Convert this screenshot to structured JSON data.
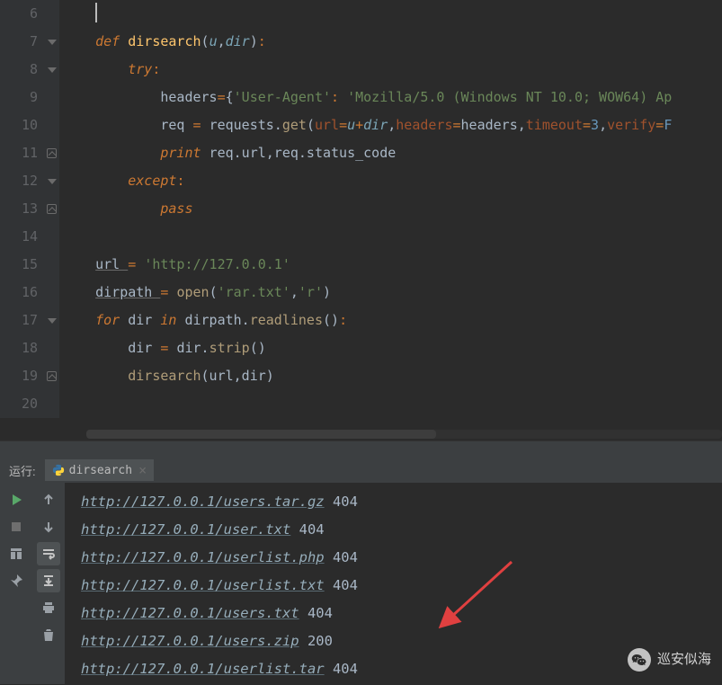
{
  "editor": {
    "lines": [
      {
        "n": 6,
        "fold": null,
        "tokens": [
          {
            "t": "cursor"
          }
        ],
        "indent": 0
      },
      {
        "n": 7,
        "fold": "open",
        "tokens": [
          {
            "c": "kw",
            "v": "def "
          },
          {
            "c": "fn-name",
            "v": "dirsearch"
          },
          {
            "c": "ident",
            "v": "("
          },
          {
            "c": "param",
            "v": "u"
          },
          {
            "c": "ident",
            "v": ","
          },
          {
            "c": "param",
            "v": "dir"
          },
          {
            "c": "ident",
            "v": ")"
          },
          {
            "c": "kw2",
            "v": ":"
          }
        ],
        "indent": 0
      },
      {
        "n": 8,
        "fold": "open",
        "tokens": [
          {
            "c": "kw",
            "v": "try"
          },
          {
            "c": "kw2",
            "v": ":"
          }
        ],
        "indent": 1
      },
      {
        "n": 9,
        "fold": null,
        "tokens": [
          {
            "c": "ident",
            "v": "headers"
          },
          {
            "c": "kw2",
            "v": "="
          },
          {
            "c": "ident",
            "v": "{"
          },
          {
            "c": "str",
            "v": "'User-Agent'"
          },
          {
            "c": "kw2",
            "v": ": "
          },
          {
            "c": "str",
            "v": "'Mozilla/5.0 (Windows NT 10.0; WOW64) Ap"
          }
        ],
        "indent": 2
      },
      {
        "n": 10,
        "fold": null,
        "tokens": [
          {
            "c": "ident",
            "v": "req "
          },
          {
            "c": "kw2",
            "v": "= "
          },
          {
            "c": "ident",
            "v": "requests."
          },
          {
            "c": "method",
            "v": "get"
          },
          {
            "c": "ident",
            "v": "("
          },
          {
            "c": "named",
            "v": "url"
          },
          {
            "c": "kw2",
            "v": "="
          },
          {
            "c": "param",
            "v": "u"
          },
          {
            "c": "kw2",
            "v": "+"
          },
          {
            "c": "param",
            "v": "dir"
          },
          {
            "c": "ident",
            "v": ","
          },
          {
            "c": "named",
            "v": "headers"
          },
          {
            "c": "kw2",
            "v": "="
          },
          {
            "c": "ident",
            "v": "headers,"
          },
          {
            "c": "named",
            "v": "timeout"
          },
          {
            "c": "kw2",
            "v": "="
          },
          {
            "c": "num",
            "v": "3"
          },
          {
            "c": "ident",
            "v": ","
          },
          {
            "c": "named",
            "v": "verify"
          },
          {
            "c": "kw2",
            "v": "="
          },
          {
            "c": "num",
            "v": "F"
          }
        ],
        "indent": 2
      },
      {
        "n": 11,
        "fold": "close",
        "tokens": [
          {
            "c": "kw",
            "v": "print"
          },
          {
            "c": "ident",
            "v": " req.url,req.status_code"
          }
        ],
        "indent": 2
      },
      {
        "n": 12,
        "fold": "open",
        "tokens": [
          {
            "c": "kw",
            "v": "except"
          },
          {
            "c": "kw2",
            "v": ":"
          }
        ],
        "indent": 1
      },
      {
        "n": 13,
        "fold": "close",
        "tokens": [
          {
            "c": "kw",
            "v": "pass"
          }
        ],
        "indent": 2
      },
      {
        "n": 14,
        "fold": null,
        "tokens": [],
        "indent": 0
      },
      {
        "n": 15,
        "fold": null,
        "tokens": [
          {
            "c": "ident underline",
            "v": "url "
          },
          {
            "c": "kw2",
            "v": "= "
          },
          {
            "c": "str",
            "v": "'http://127.0.0.1'"
          }
        ],
        "indent": 0
      },
      {
        "n": 16,
        "fold": null,
        "tokens": [
          {
            "c": "ident underline",
            "v": "dirpath "
          },
          {
            "c": "kw2",
            "v": "= "
          },
          {
            "c": "call",
            "v": "open"
          },
          {
            "c": "ident",
            "v": "("
          },
          {
            "c": "str",
            "v": "'rar.txt'"
          },
          {
            "c": "ident",
            "v": ","
          },
          {
            "c": "str",
            "v": "'r'"
          },
          {
            "c": "ident",
            "v": ")"
          }
        ],
        "indent": 0
      },
      {
        "n": 17,
        "fold": "open",
        "tokens": [
          {
            "c": "kw",
            "v": "for"
          },
          {
            "c": "ident",
            "v": " dir "
          },
          {
            "c": "kw",
            "v": "in"
          },
          {
            "c": "ident",
            "v": " dirpath."
          },
          {
            "c": "method",
            "v": "readlines"
          },
          {
            "c": "ident",
            "v": "()"
          },
          {
            "c": "kw2",
            "v": ":"
          }
        ],
        "indent": 0
      },
      {
        "n": 18,
        "fold": null,
        "tokens": [
          {
            "c": "ident",
            "v": "dir "
          },
          {
            "c": "kw2",
            "v": "= "
          },
          {
            "c": "ident",
            "v": "dir."
          },
          {
            "c": "method",
            "v": "strip"
          },
          {
            "c": "ident",
            "v": "()"
          }
        ],
        "indent": 1
      },
      {
        "n": 19,
        "fold": "close",
        "tokens": [
          {
            "c": "call",
            "v": "dirsearch"
          },
          {
            "c": "ident",
            "v": "(url,dir)"
          }
        ],
        "indent": 1
      },
      {
        "n": 20,
        "fold": null,
        "tokens": [],
        "indent": 0
      }
    ]
  },
  "console": {
    "run_label": "运行:",
    "tab_title": "dirsearch",
    "output": [
      {
        "url": "http://127.0.0.1/users.tar.gz",
        "code": "404"
      },
      {
        "url": "http://127.0.0.1/user.txt",
        "code": "404"
      },
      {
        "url": "http://127.0.0.1/userlist.php",
        "code": "404"
      },
      {
        "url": "http://127.0.0.1/userlist.txt",
        "code": "404"
      },
      {
        "url": "http://127.0.0.1/users.txt",
        "code": "404"
      },
      {
        "url": "http://127.0.0.1/users.zip",
        "code": "200"
      },
      {
        "url": "http://127.0.0.1/userlist.tar",
        "code": "404"
      }
    ]
  },
  "watermark": "巡安似海"
}
